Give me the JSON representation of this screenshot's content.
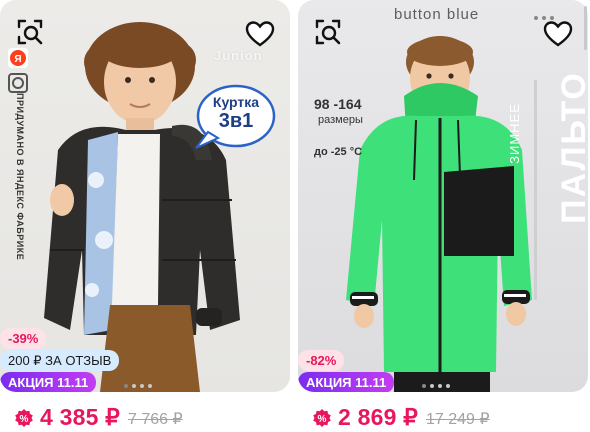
{
  "products": [
    {
      "discount": "-39%",
      "review_bonus": "200 ₽ ЗА ОТЗЫВ",
      "promo": "АКЦИЯ 11.11",
      "price": "4 385 ₽",
      "old_price": "7 766 ₽",
      "photo_text": {
        "ya_vertical": "ПРИДУМАНО В ЯНДЕКС ФАБРИКЕ",
        "brand": "Junion",
        "bubble_line1": "Куртка",
        "bubble_line2": "3в1"
      },
      "jacket_color": "#2f2d2b"
    },
    {
      "discount": "-82%",
      "promo": "АКЦИЯ 11.11",
      "price": "2 869 ₽",
      "old_price": "17 249 ₽",
      "photo_text": {
        "brand": "button blue",
        "sizes": "98 -164",
        "sizes_label": "размеры",
        "temp": "до -25 °С",
        "vertical_small": "ЗИМНЕЕ",
        "vertical_big": "ПАЛЬТО"
      },
      "jacket_color": "#3ee07a"
    }
  ],
  "colors": {
    "accent": "#e8175d",
    "promo_start": "#7b2cf0",
    "promo_end": "#c33df2",
    "review_bg": "#d6ebff"
  },
  "icons": [
    "image-search-icon",
    "heart-icon",
    "discount-badge-icon"
  ]
}
